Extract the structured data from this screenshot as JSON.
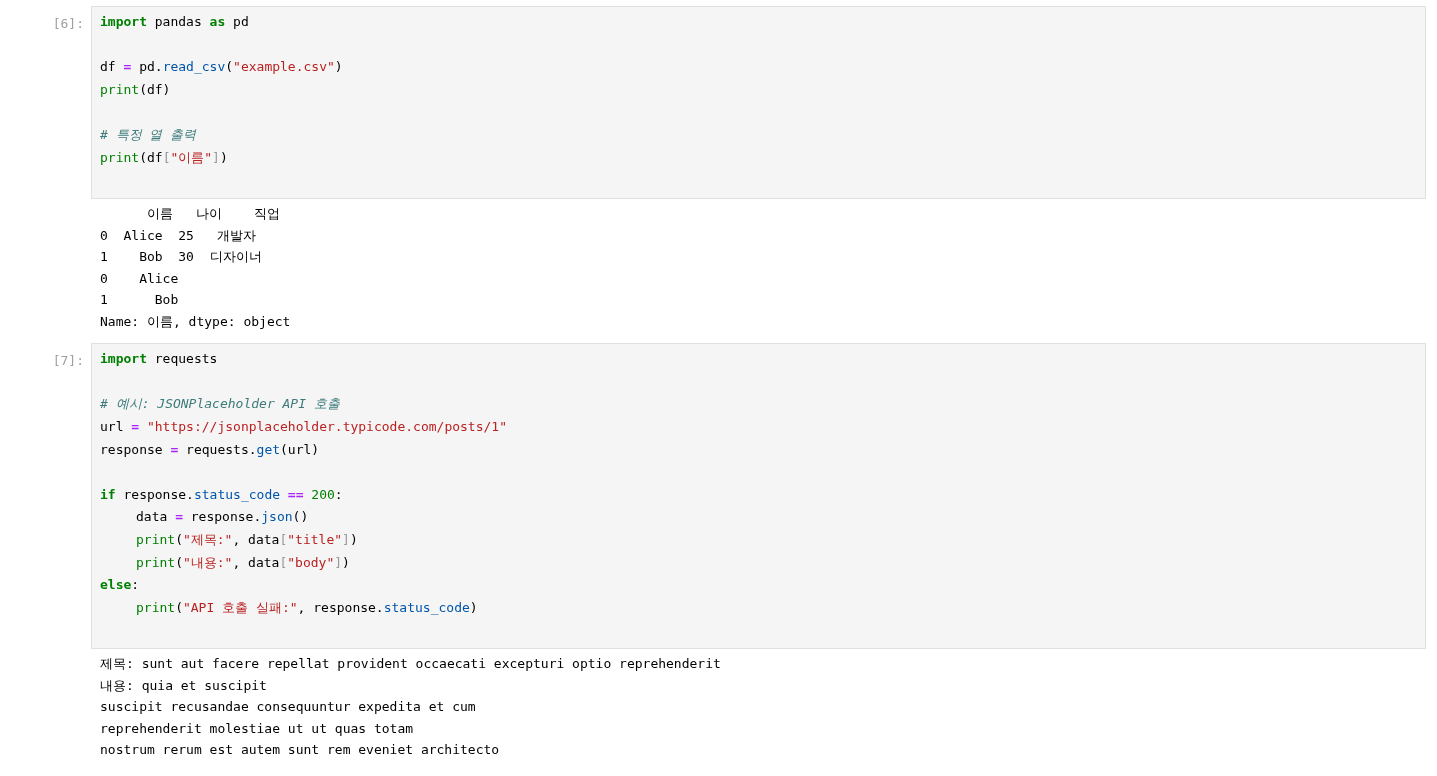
{
  "cells": [
    {
      "prompt": "[6]:",
      "code": [
        {
          "tokens": [
            {
              "kind": "kw",
              "text": "import"
            },
            {
              "kind": "plain",
              "text": " pandas "
            },
            {
              "kind": "kw",
              "text": "as"
            },
            {
              "kind": "plain",
              "text": " pd"
            }
          ]
        },
        {
          "space_before": true,
          "tokens": [
            {
              "kind": "plain",
              "text": "df "
            },
            {
              "kind": "op",
              "text": "="
            },
            {
              "kind": "plain",
              "text": " pd."
            },
            {
              "kind": "attr",
              "text": "read_csv"
            },
            {
              "kind": "plain",
              "text": "("
            },
            {
              "kind": "str",
              "text": "\"example.csv\""
            },
            {
              "kind": "plain",
              "text": ")"
            }
          ]
        },
        {
          "tokens": [
            {
              "kind": "builtin",
              "text": "print"
            },
            {
              "kind": "plain",
              "text": "(df)"
            }
          ]
        },
        {
          "space_before": true,
          "tokens": [
            {
              "kind": "comment",
              "text": "# 특정 열 출력"
            }
          ]
        },
        {
          "tokens": [
            {
              "kind": "builtin",
              "text": "print"
            },
            {
              "kind": "plain",
              "text": "(df"
            },
            {
              "kind": "bracket",
              "text": "["
            },
            {
              "kind": "str",
              "text": "\"이름\""
            },
            {
              "kind": "bracket",
              "text": "]"
            },
            {
              "kind": "plain",
              "text": ")"
            }
          ]
        }
      ],
      "output": [
        "      이름   나이    직업",
        "0  Alice  25   개발자",
        "1    Bob  30  디자이너",
        "0    Alice",
        "1      Bob",
        "Name: 이름, dtype: object"
      ]
    },
    {
      "prompt": "[7]:",
      "code": [
        {
          "tokens": [
            {
              "kind": "kw",
              "text": "import"
            },
            {
              "kind": "plain",
              "text": " requests"
            }
          ]
        },
        {
          "space_before": true,
          "tokens": [
            {
              "kind": "comment",
              "text": "# 예시: JSONPlaceholder API 호출"
            }
          ]
        },
        {
          "tokens": [
            {
              "kind": "plain",
              "text": "url "
            },
            {
              "kind": "op",
              "text": "= "
            },
            {
              "kind": "str",
              "text": "\"https://jsonplaceholder.typicode.com/posts/1\""
            }
          ]
        },
        {
          "tokens": [
            {
              "kind": "plain",
              "text": "response "
            },
            {
              "kind": "op",
              "text": "="
            },
            {
              "kind": "plain",
              "text": " requests."
            },
            {
              "kind": "attr",
              "text": "get"
            },
            {
              "kind": "plain",
              "text": "(url)"
            }
          ]
        },
        {
          "space_before": true,
          "tokens": [
            {
              "kind": "kw",
              "text": "if"
            },
            {
              "kind": "plain",
              "text": " response."
            },
            {
              "kind": "attr",
              "text": "status_code"
            },
            {
              "kind": "op",
              "text": " == "
            },
            {
              "kind": "num",
              "text": "200"
            },
            {
              "kind": "plain",
              "text": ":"
            }
          ]
        },
        {
          "indent": true,
          "tokens": [
            {
              "kind": "plain",
              "text": "data "
            },
            {
              "kind": "op",
              "text": "="
            },
            {
              "kind": "plain",
              "text": " response."
            },
            {
              "kind": "attr",
              "text": "json"
            },
            {
              "kind": "plain",
              "text": "()"
            }
          ]
        },
        {
          "indent": true,
          "tokens": [
            {
              "kind": "builtin",
              "text": "print"
            },
            {
              "kind": "plain",
              "text": "("
            },
            {
              "kind": "str",
              "text": "\"제목:\""
            },
            {
              "kind": "plain",
              "text": ", data"
            },
            {
              "kind": "bracket",
              "text": "["
            },
            {
              "kind": "str",
              "text": "\"title\""
            },
            {
              "kind": "bracket",
              "text": "]"
            },
            {
              "kind": "plain",
              "text": ")"
            }
          ]
        },
        {
          "indent": true,
          "tokens": [
            {
              "kind": "builtin",
              "text": "print"
            },
            {
              "kind": "plain",
              "text": "("
            },
            {
              "kind": "str",
              "text": "\"내용:\""
            },
            {
              "kind": "plain",
              "text": ", data"
            },
            {
              "kind": "bracket",
              "text": "["
            },
            {
              "kind": "str",
              "text": "\"body\""
            },
            {
              "kind": "bracket",
              "text": "]"
            },
            {
              "kind": "plain",
              "text": ")"
            }
          ]
        },
        {
          "tokens": [
            {
              "kind": "kw",
              "text": "else"
            },
            {
              "kind": "plain",
              "text": ":"
            }
          ]
        },
        {
          "indent": true,
          "tokens": [
            {
              "kind": "builtin",
              "text": "print"
            },
            {
              "kind": "plain",
              "text": "("
            },
            {
              "kind": "str",
              "text": "\"API 호출 실패:\""
            },
            {
              "kind": "plain",
              "text": ", response."
            },
            {
              "kind": "attr",
              "text": "status_code"
            },
            {
              "kind": "plain",
              "text": ")"
            }
          ]
        }
      ],
      "output": [
        "제목: sunt aut facere repellat provident occaecati excepturi optio reprehenderit",
        "내용: quia et suscipit",
        "suscipit recusandae consequuntur expedita et cum",
        "reprehenderit molestiae ut ut quas totam",
        "nostrum rerum est autem sunt rem eveniet architecto"
      ]
    }
  ]
}
